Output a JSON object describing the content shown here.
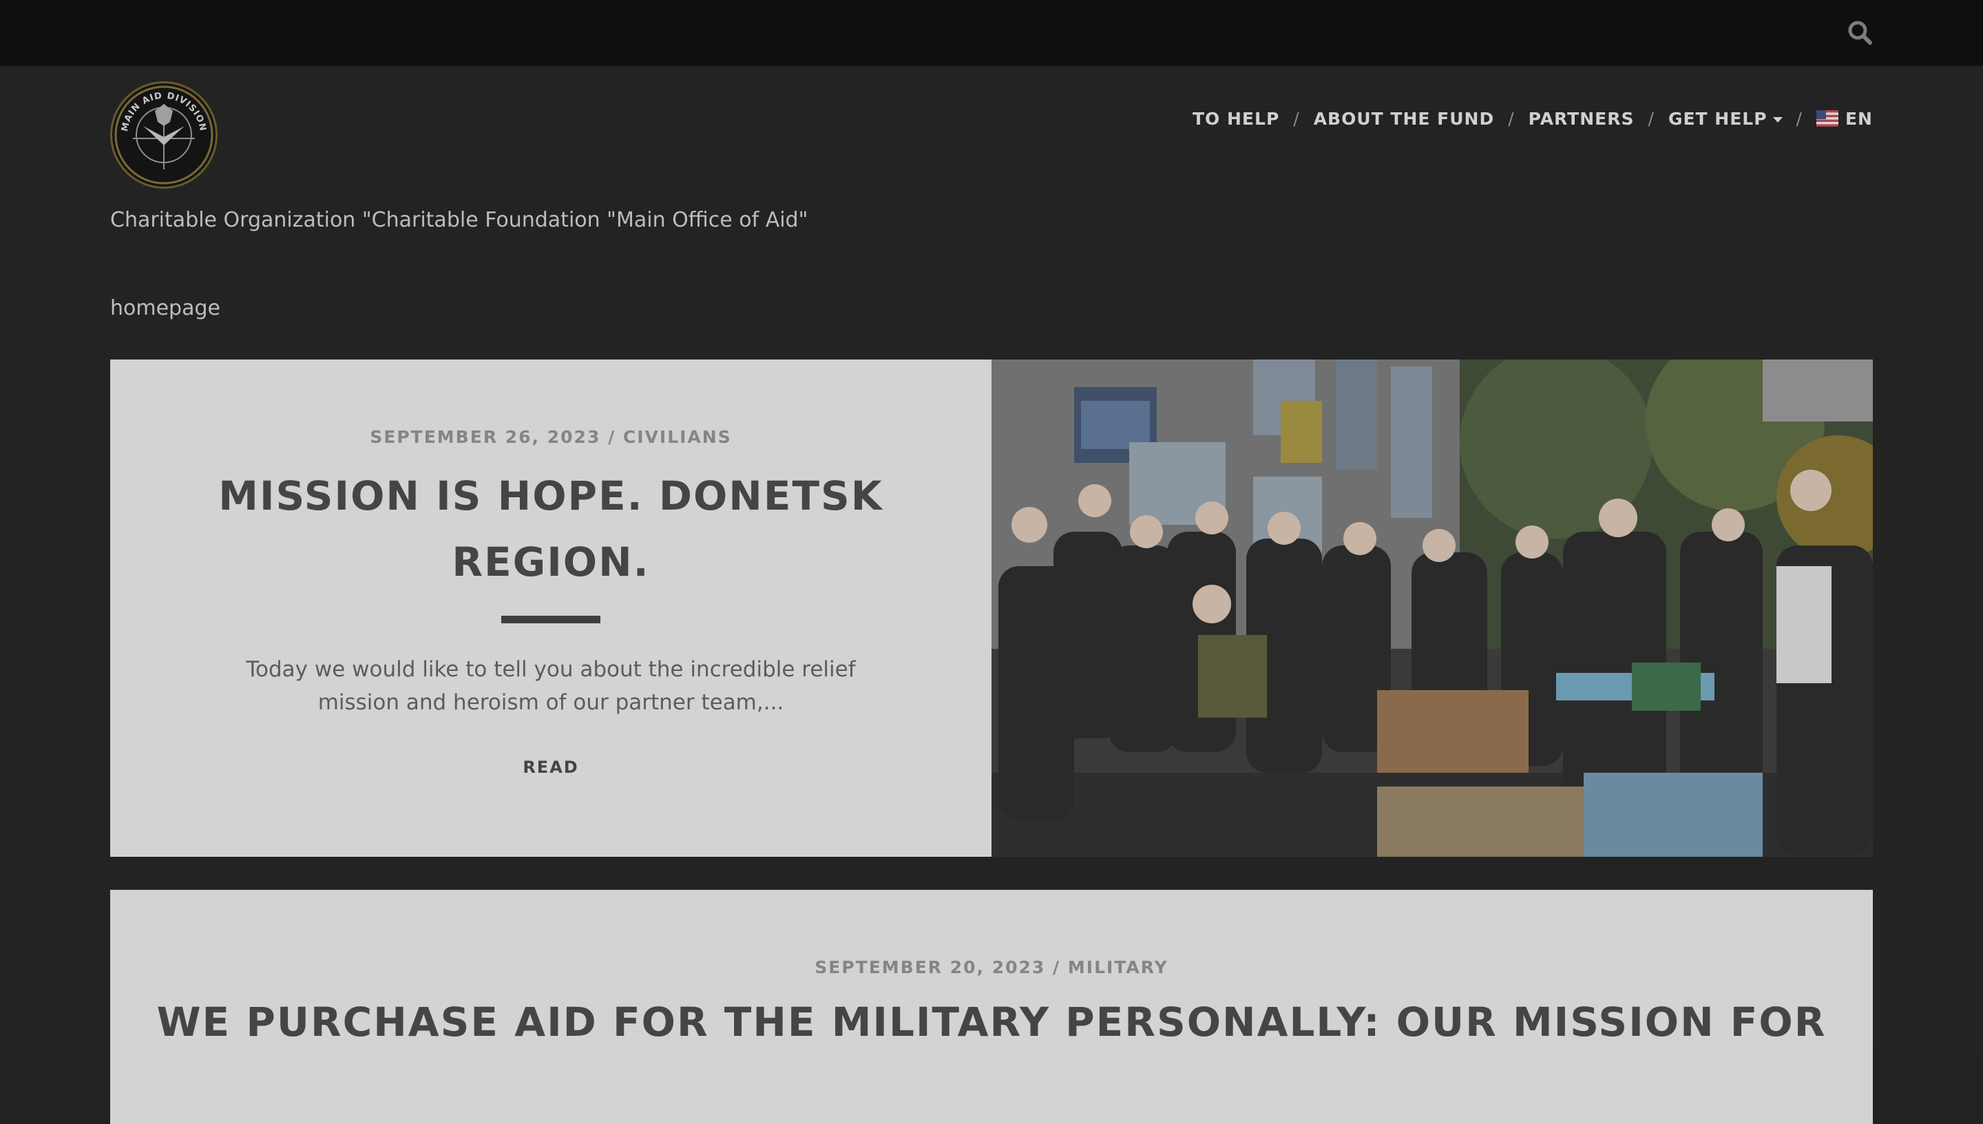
{
  "topbar": {
    "search_icon": "search-icon"
  },
  "header": {
    "logo_icon": "main-aid-division-emblem",
    "logo_text": "MAIN AID DIVISION",
    "org_name": "Charitable Organization \"Charitable Foundation \"Main Office of Aid\""
  },
  "nav": {
    "items": [
      {
        "label": "TO HELP"
      },
      {
        "label": "ABOUT THE FUND"
      },
      {
        "label": "PARTNERS"
      },
      {
        "label": "GET HELP"
      },
      {
        "label": "EN"
      }
    ],
    "separator": "/",
    "language_flag_icon": "us-flag-icon"
  },
  "breadcrumb": "homepage",
  "posts": [
    {
      "date": "SEPTEMBER 26, 2023",
      "category": "CIVILIANS",
      "title": "MISSION IS HOPE. DONETSK REGION.",
      "excerpt": "Today we would like to tell you about the incredible relief mission and heroism of our partner team,...",
      "read_label": "READ"
    },
    {
      "date": "SEPTEMBER 20, 2023",
      "category": "MILITARY",
      "title": "WE PURCHASE AID FOR THE MILITARY PERSONALLY: OUR MISSION FOR"
    }
  ],
  "colors": {
    "page_bg": "#232323",
    "topbar_bg": "#0f0f0f",
    "card_bg": "#d3d3d3",
    "title_text": "#454545"
  }
}
